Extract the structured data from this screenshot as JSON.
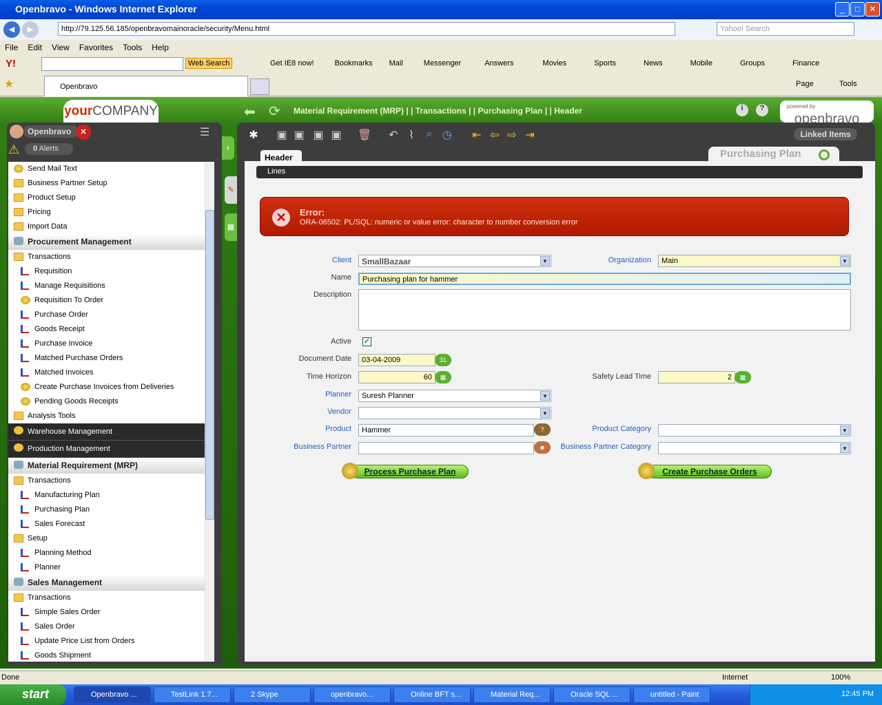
{
  "window": {
    "title": "Openbravo - Windows Internet Explorer"
  },
  "ie": {
    "url": "http://79.125.56.185/openbravomainoracle/security/Menu.html",
    "search_placeholder": "Yahoo! Search",
    "menu": [
      "File",
      "Edit",
      "View",
      "Favorites",
      "Tools",
      "Help"
    ],
    "yahoo": {
      "web_search": "Web Search",
      "items": [
        "Get IE8 now!",
        "Bookmarks",
        "Mail",
        "Messenger",
        "Answers",
        "Movies",
        "Sports",
        "News",
        "Mobile",
        "Groups",
        "Finance"
      ]
    },
    "tab": "Openbravo",
    "cmd": [
      "Page",
      "Tools"
    ]
  },
  "app": {
    "logo_bold": "your",
    "logo_rest": "COMPANY",
    "breadcrumb": "Material Requirement (MRP) | | Transactions | | Purchasing Plan | | Header",
    "powered_by": "powered by",
    "brand": "openbravo",
    "user": "Openbravo",
    "alerts_count": "0",
    "alerts_label": "Alerts",
    "linked_items": "Linked Items",
    "tab_header": "Header",
    "tab_lines": "Lines",
    "window_title": "Purchasing Plan"
  },
  "menu": [
    {
      "label": "Send Mail Text",
      "type": "proc"
    },
    {
      "label": "Business Partner Setup",
      "type": "folder"
    },
    {
      "label": "Product Setup",
      "type": "folder"
    },
    {
      "label": "Pricing",
      "type": "folder"
    },
    {
      "label": "Import Data",
      "type": "folder"
    },
    {
      "label": "Procurement Management",
      "type": "sec"
    },
    {
      "label": "Transactions",
      "type": "folder"
    },
    {
      "label": "Requisition",
      "type": "doc"
    },
    {
      "label": "Manage Requisitions",
      "type": "doc"
    },
    {
      "label": "Requisition To Order",
      "type": "proc2"
    },
    {
      "label": "Purchase Order",
      "type": "doc"
    },
    {
      "label": "Goods Receipt",
      "type": "doc"
    },
    {
      "label": "Purchase Invoice",
      "type": "doc"
    },
    {
      "label": "Matched Purchase Orders",
      "type": "doc"
    },
    {
      "label": "Matched Invoices",
      "type": "doc"
    },
    {
      "label": "Create Purchase Invoices from Deliveries",
      "type": "proc2"
    },
    {
      "label": "Pending Goods Receipts",
      "type": "proc2"
    },
    {
      "label": "Analysis Tools",
      "type": "folder"
    },
    {
      "label": "Warehouse Management",
      "type": "dark"
    },
    {
      "label": "Production Management",
      "type": "dark"
    },
    {
      "label": "Material Requirement (MRP)",
      "type": "sec"
    },
    {
      "label": "Transactions",
      "type": "folder"
    },
    {
      "label": "Manufacturing Plan",
      "type": "doc"
    },
    {
      "label": "Purchasing Plan",
      "type": "doc"
    },
    {
      "label": "Sales Forecast",
      "type": "doc"
    },
    {
      "label": "Setup",
      "type": "folder"
    },
    {
      "label": "Planning Method",
      "type": "doc"
    },
    {
      "label": "Planner",
      "type": "doc"
    },
    {
      "label": "Sales Management",
      "type": "sec"
    },
    {
      "label": "Transactions",
      "type": "folder"
    },
    {
      "label": "Simple Sales Order",
      "type": "doc"
    },
    {
      "label": "Sales Order",
      "type": "doc"
    },
    {
      "label": "Update Price List from Orders",
      "type": "doc"
    },
    {
      "label": "Goods Shipment",
      "type": "doc"
    }
  ],
  "error": {
    "title": "Error:",
    "message": "ORA-06502: PL/SQL: numeric or value error: character to number conversion error"
  },
  "form": {
    "client_label": "Client",
    "client": "SmallBazaar",
    "org_label": "Organization",
    "org": "Main",
    "name_label": "Name",
    "name": "Purchasing plan for hammer",
    "desc_label": "Description",
    "desc": "",
    "active_label": "Active",
    "active": "✓",
    "docdate_label": "Document Date",
    "docdate": "03-04-2009",
    "horizon_label": "Time Horizon",
    "horizon": "60",
    "safety_label": "Safety Lead Time",
    "safety": "2",
    "planner_label": "Planner",
    "planner": "Suresh Planner",
    "vendor_label": "Vendor",
    "vendor": "",
    "product_label": "Product",
    "product": "Hammer",
    "pcat_label": "Product Category",
    "pcat": "",
    "bp_label": "Business Partner",
    "bp": "",
    "bpcat_label": "Business Partner Category",
    "bpcat": "",
    "process_btn": "Process Purchase Plan",
    "create_btn": "Create Purchase Orders"
  },
  "status": {
    "text": "Done",
    "zone": "Internet",
    "zoom": "100%"
  },
  "taskbar": {
    "start": "start",
    "tasks": [
      "Openbravo ...",
      "TestLink 1.7...",
      "2 Skype",
      "openbravo...",
      "Online BFT s...",
      "Material Req...",
      "Oracle SQL ...",
      "untitled - Paint"
    ],
    "clock": "12:45 PM"
  }
}
